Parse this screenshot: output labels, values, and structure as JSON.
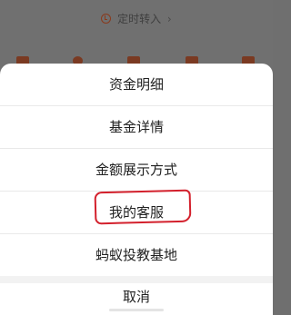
{
  "background": {
    "top_link_label": "定时转入",
    "top_link_chevron": "›"
  },
  "action_sheet": {
    "items": [
      {
        "label": "资金明细"
      },
      {
        "label": "基金详情"
      },
      {
        "label": "金额展示方式"
      },
      {
        "label": "我的客服"
      },
      {
        "label": "蚂蚁投教基地"
      }
    ],
    "cancel_label": "取消"
  },
  "colors": {
    "overlay": "#707070",
    "sheet": "#ffffff",
    "annotation": "#d3202c",
    "text": "#222222"
  }
}
